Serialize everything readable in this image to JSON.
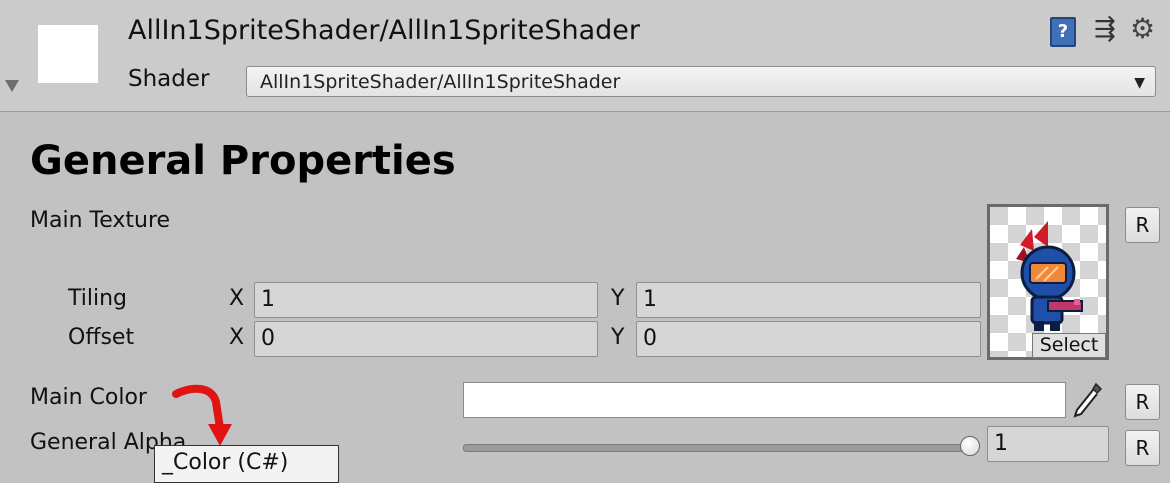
{
  "header": {
    "material_title": "AllIn1SpriteShader/AllIn1SpriteShader",
    "shader_label": "Shader",
    "shader_value": "AllIn1SpriteShader/AllIn1SpriteShader",
    "icons": [
      "book-help-icon",
      "preset-icon",
      "gear-icon"
    ]
  },
  "section": {
    "title": "General Properties"
  },
  "main_texture": {
    "label": "Main Texture",
    "tiling_label": "Tiling",
    "offset_label": "Offset",
    "axis_x": "X",
    "axis_y": "Y",
    "tiling_x": "1",
    "tiling_y": "1",
    "offset_x": "0",
    "offset_y": "0",
    "select_label": "Select",
    "reset_label": "R"
  },
  "main_color": {
    "label": "Main Color",
    "value": "#ffffff",
    "reset_label": "R"
  },
  "general_alpha": {
    "label": "General Alpha",
    "value": "1",
    "slider_fraction": 1.0,
    "reset_label": "R"
  },
  "tooltip": {
    "text": "_Color (C#)"
  },
  "colors": {
    "header_bg": "#cbcbcb",
    "panel_bg": "#c2c2c2",
    "annotation_red": "#e01414"
  }
}
